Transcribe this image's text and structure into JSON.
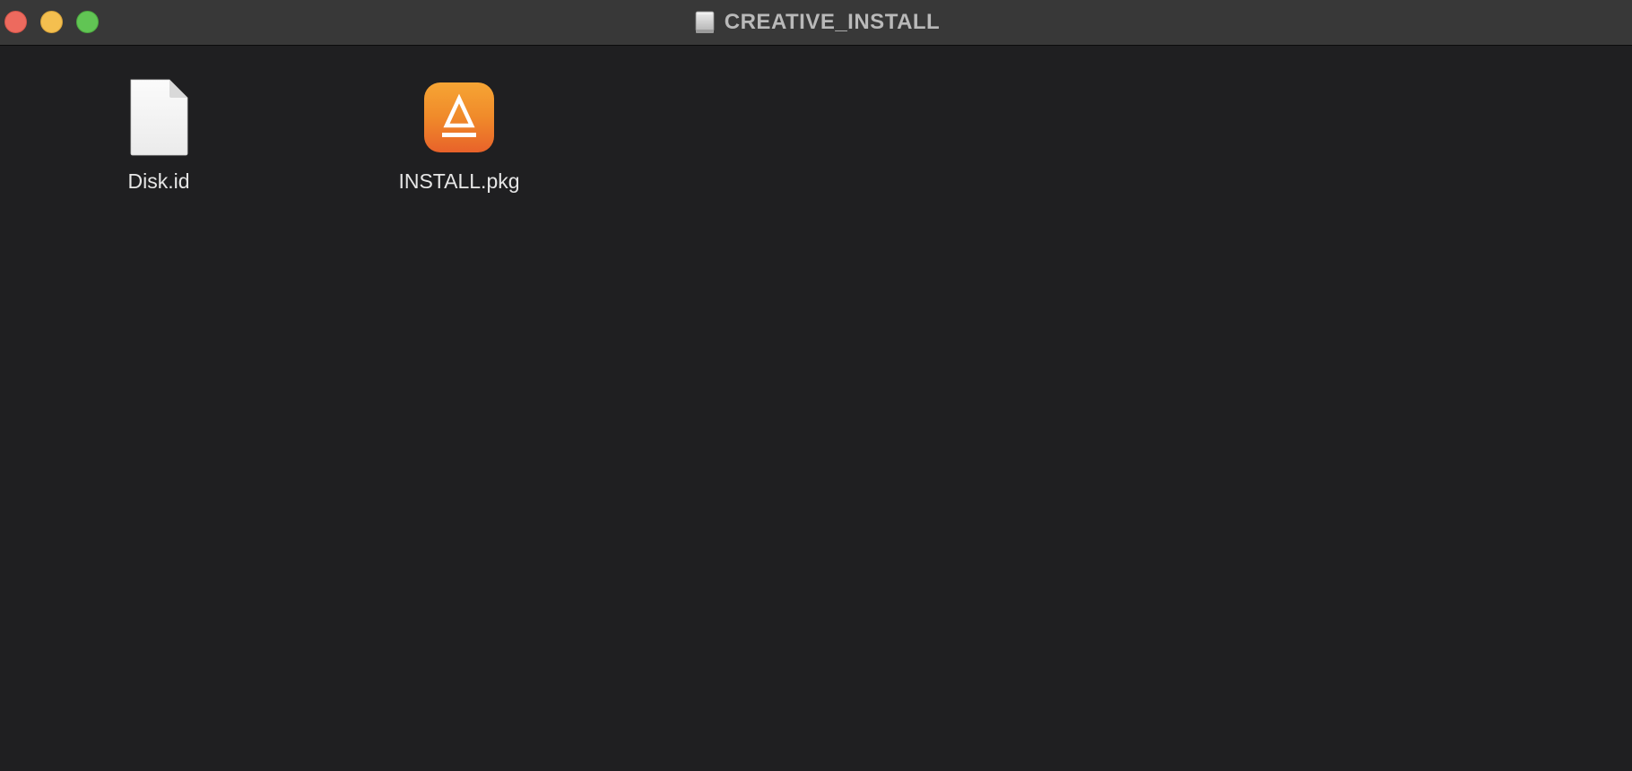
{
  "window": {
    "title": "CREATIVE_INSTALL",
    "title_icon": "external-drive-icon"
  },
  "traffic_lights": {
    "close_color": "#ed6a5e",
    "minimize_color": "#f4bf4f",
    "zoom_color": "#61c554"
  },
  "files": [
    {
      "name": "Disk.id",
      "icon": "document-icon"
    },
    {
      "name": "INSTALL.pkg",
      "icon": "installer-package-icon"
    }
  ],
  "colors": {
    "background": "#1f1f21",
    "titlebar": "#383838",
    "pkg_accent_top": "#f6a534",
    "pkg_accent_bottom": "#e8622a"
  }
}
